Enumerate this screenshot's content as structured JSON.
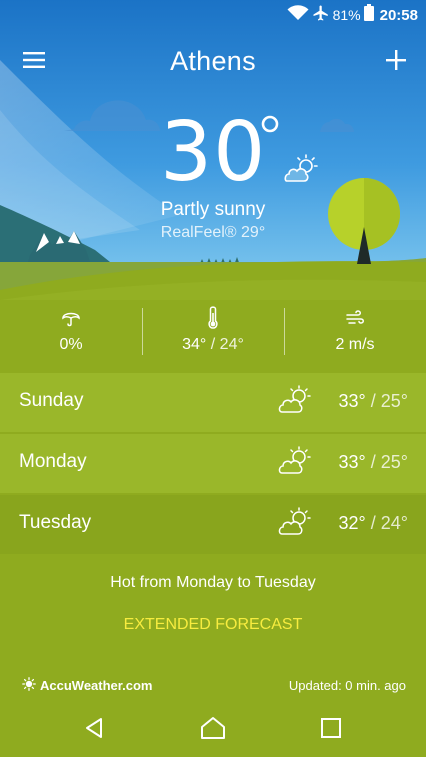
{
  "status_bar": {
    "battery": "81%",
    "time": "20:58",
    "icons": [
      "wifi-icon",
      "airplane-icon",
      "battery-icon"
    ]
  },
  "header": {
    "city": "Athens",
    "menu_icon": "menu-icon",
    "add_icon": "plus-icon"
  },
  "current": {
    "temperature": "30",
    "degree": "°",
    "condition": "Partly sunny",
    "realfeel": "RealFeel® 29°",
    "icon": "partly-sunny-icon"
  },
  "metrics": {
    "precipitation": {
      "icon": "umbrella-icon",
      "value": "0%"
    },
    "temperature": {
      "icon": "thermometer-icon",
      "high": "34°",
      "sep": " / ",
      "low": "24°"
    },
    "wind": {
      "icon": "wind-icon",
      "value": "2 m/s"
    }
  },
  "forecast": [
    {
      "day": "Sunday",
      "high": "33°",
      "sep": " / ",
      "low": "25°",
      "icon": "partly-sunny-icon"
    },
    {
      "day": "Monday",
      "high": "33°",
      "sep": " / ",
      "low": "25°",
      "icon": "partly-sunny-icon"
    },
    {
      "day": "Tuesday",
      "high": "32°",
      "sep": " / ",
      "low": "24°",
      "icon": "partly-sunny-icon"
    }
  ],
  "summary": "Hot from Monday to Tuesday",
  "extended_forecast": "EXTENDED FORECAST",
  "footer": {
    "brand": "AccuWeather.com",
    "updated": "Updated: 0 min. ago"
  },
  "nav": {
    "icons": [
      "back-icon",
      "home-icon",
      "recents-icon"
    ]
  },
  "colors": {
    "sky_top": "#1e78c8",
    "sky_bottom": "#6ec3ee",
    "grass": "#8fab1f",
    "row_light": "#9ab72a",
    "row_dark": "#89a51d",
    "accent_yellow": "#f7ec3f",
    "tree": "#b7cf2a"
  }
}
